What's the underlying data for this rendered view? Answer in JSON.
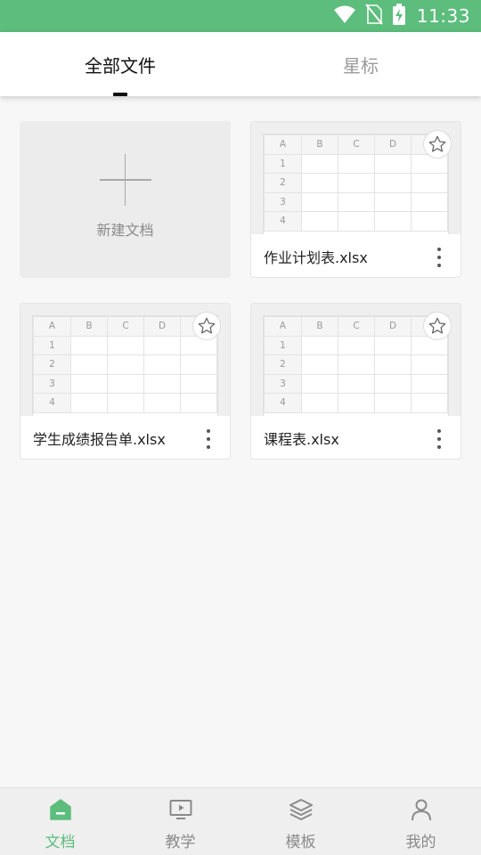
{
  "status_bar": {
    "time": "11:33",
    "color": "#5cbd7c"
  },
  "tabs": [
    {
      "label": "全部文件",
      "active": true
    },
    {
      "label": "星标",
      "active": false
    }
  ],
  "new_file": {
    "label": "新建文档"
  },
  "sheet_preview": {
    "columns": [
      "A",
      "B",
      "C",
      "D"
    ],
    "rows": [
      "1",
      "2",
      "3",
      "4"
    ]
  },
  "files": [
    {
      "name": "作业计划表.xlsx",
      "starred": false
    },
    {
      "name": "学生成绩报告单.xlsx",
      "starred": false
    },
    {
      "name": "课程表.xlsx",
      "starred": false
    }
  ],
  "bottom_nav": [
    {
      "label": "文档",
      "icon": "document-icon",
      "active": true
    },
    {
      "label": "教学",
      "icon": "presentation-icon",
      "active": false
    },
    {
      "label": "模板",
      "icon": "layers-icon",
      "active": false
    },
    {
      "label": "我的",
      "icon": "person-icon",
      "active": false
    }
  ],
  "accent": "#5cbd7c"
}
